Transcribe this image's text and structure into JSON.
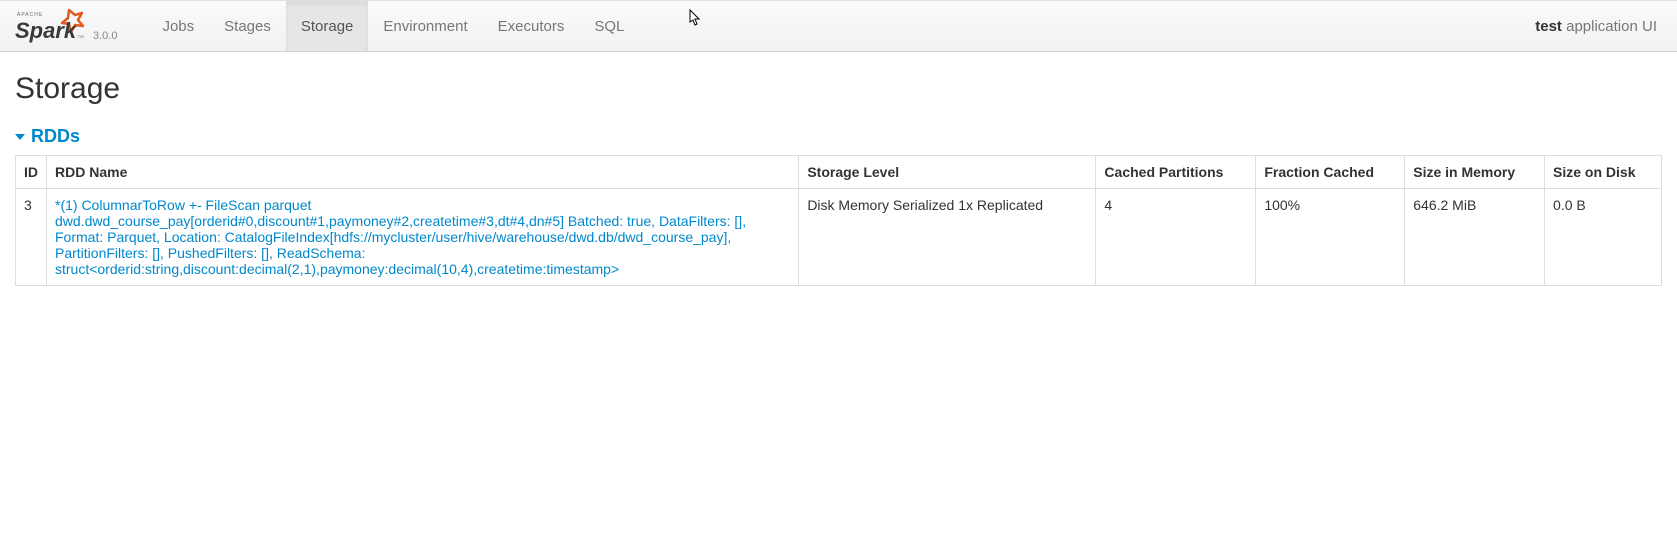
{
  "brand": {
    "version": "3.0.0"
  },
  "nav": {
    "tabs": [
      "Jobs",
      "Stages",
      "Storage",
      "Environment",
      "Executors",
      "SQL"
    ],
    "active": "Storage"
  },
  "app": {
    "name_strong": "test",
    "name_rest": " application UI"
  },
  "page": {
    "title": "Storage",
    "section": "RDDs"
  },
  "table": {
    "headers": [
      "ID",
      "RDD Name",
      "Storage Level",
      "Cached Partitions",
      "Fraction Cached",
      "Size in Memory",
      "Size on Disk"
    ],
    "rows": [
      {
        "id": "3",
        "name": "*(1) ColumnarToRow +- FileScan parquet dwd.dwd_course_pay[orderid#0,discount#1,paymoney#2,createtime#3,dt#4,dn#5] Batched: true, DataFilters: [], Format: Parquet, Location: CatalogFileIndex[hdfs://mycluster/user/hive/warehouse/dwd.db/dwd_course_pay], PartitionFilters: [], PushedFilters: [], ReadSchema: struct<orderid:string,discount:decimal(2,1),paymoney:decimal(10,4),createtime:timestamp>",
        "storage_level": "Disk Memory Serialized 1x Replicated",
        "cached_partitions": "4",
        "fraction_cached": "100%",
        "size_in_memory": "646.2 MiB",
        "size_on_disk": "0.0 B"
      }
    ]
  }
}
